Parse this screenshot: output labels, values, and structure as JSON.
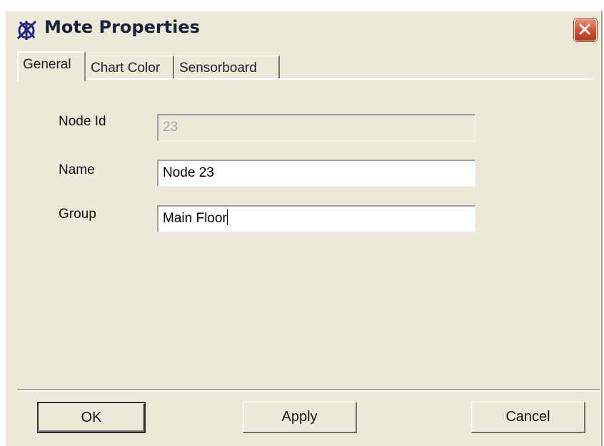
{
  "window": {
    "title": "Mote Properties",
    "app_icon": "mote-app-icon",
    "close_icon": "close-icon",
    "close_color": "#d2502f"
  },
  "tabs": [
    {
      "label": "General",
      "active": true
    },
    {
      "label": "Chart Color",
      "active": false
    },
    {
      "label": "Sensorboard",
      "active": false
    }
  ],
  "form": {
    "node_id": {
      "label": "Node Id",
      "value": "23",
      "enabled": false
    },
    "name": {
      "label": "Name",
      "value": "Node 23",
      "enabled": true
    },
    "group": {
      "label": "Group",
      "value": "Main Floor",
      "enabled": true,
      "focused": true
    }
  },
  "buttons": {
    "ok": "OK",
    "apply": "Apply",
    "cancel": "Cancel"
  }
}
